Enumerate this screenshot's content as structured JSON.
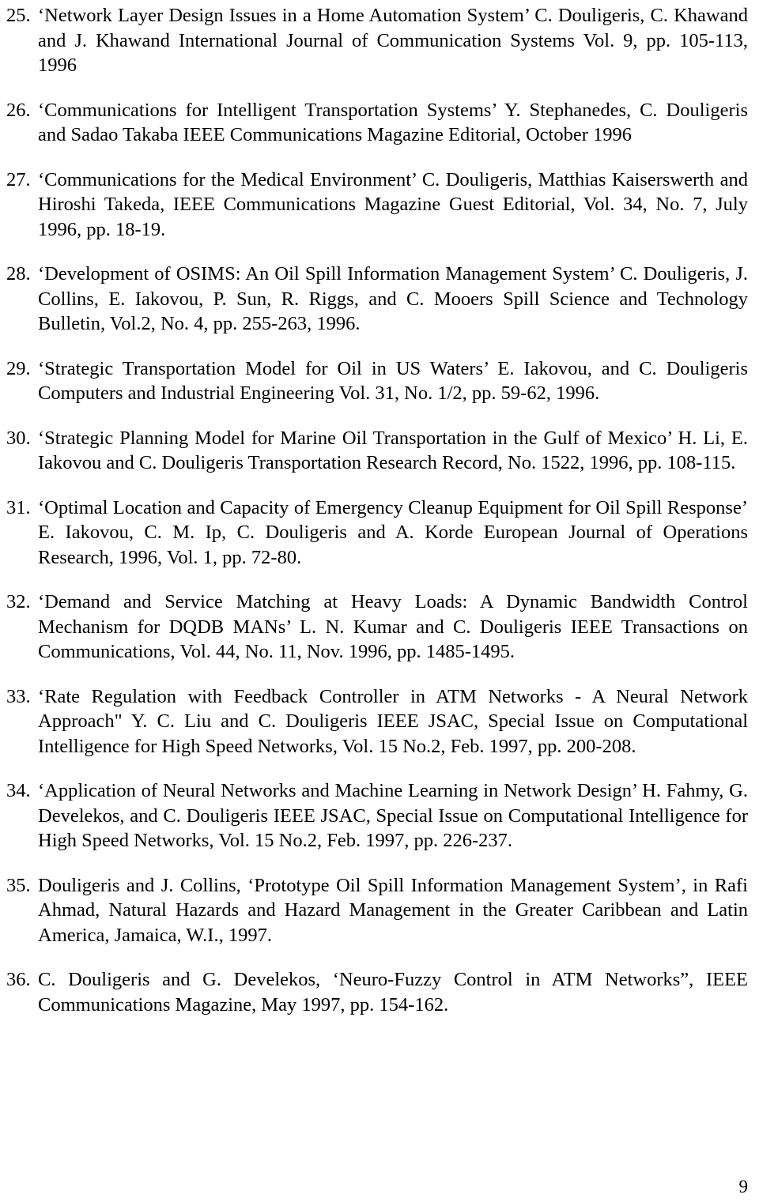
{
  "document": {
    "page_number": "9",
    "references": [
      {
        "number": "25.",
        "text": "‘Network Layer Design Issues  in a Home Automation System’ C. Douligeris, C. Khawand and  J. Khawand International Journal of Communication Systems Vol. 9, pp. 105-113, 1996"
      },
      {
        "number": "26.",
        "text": "‘Communications for Intelligent Transportation Systems’ Y. Stephanedes, C. Douligeris and Sadao Takaba IEEE Communications Magazine Editorial, October 1996"
      },
      {
        "number": "27.",
        "text": "‘Communications for the Medical Environment’ C. Douligeris, Matthias Kaiserswerth and Hiroshi Takeda, IEEE Communications Magazine Guest Editorial, Vol. 34, No. 7, July 1996, pp. 18-19."
      },
      {
        "number": "28.",
        "text": "‘Development of OSIMS: An Oil Spill Information Management System’ C. Douligeris, J. Collins, E. Iakovou, P. Sun, R. Riggs, and C. Mooers Spill Science and Technology Bulletin,  Vol.2, No. 4, pp. 255-263, 1996."
      },
      {
        "number": "29.",
        "text": "‘Strategic Transportation Model for Oil in US Waters’ E. Iakovou, and C. Douligeris Computers and Industrial Engineering Vol. 31, No. 1/2, pp.  59-62, 1996."
      },
      {
        "number": "30.",
        "text": "‘Strategic Planning Model for Marine Oil Transportation in the Gulf of Mexico’ H. Li, E. Iakovou and C. Douligeris Transportation Research Record, No. 1522, 1996, pp. 108-115."
      },
      {
        "number": "31.",
        "text": "‘Optimal Location and Capacity of Emergency Cleanup Equipment for Oil Spill Response’ E. Iakovou, C. M. Ip, C. Douligeris and A. Korde European Journal of Operations Research, 1996, Vol. 1, pp. 72-80."
      },
      {
        "number": "32.",
        "text": "‘Demand and Service Matching at Heavy Loads: A Dynamic Bandwidth Control Mechanism for DQDB MANs’ L. N. Kumar and C. Douligeris IEEE Transactions on Communications, Vol. 44, No. 11, Nov. 1996, pp. 1485-1495."
      },
      {
        "number": "33.",
        "text": "‘Rate Regulation with Feedback Controller in ATM Networks - A Neural Network Approach\" Y. C. Liu and C. Douligeris IEEE JSAC,  Special Issue on Computational Intelligence for High Speed Networks, Vol. 15 No.2, Feb. 1997, pp. 200-208."
      },
      {
        "number": "34.",
        "text": "‘Application of Neural Networks and Machine Learning in Network Design’ H. Fahmy, G. Develekos, and C. Douligeris IEEE JSAC, Special Issue on Computational Intelligence for High Speed Networks, Vol. 15 No.2, Feb. 1997, pp. 226-237."
      },
      {
        "number": "35.",
        "text": "Douligeris and J. Collins, ‘Prototype Oil Spill Information Management System’, in Rafi Ahmad, Natural Hazards and Hazard Management in the Greater Caribbean and Latin America, Jamaica, W.I., 1997."
      },
      {
        "number": "36.",
        "text": "C. Douligeris and G. Develekos, ‘Neuro-Fuzzy Control in ATM Networks”, IEEE Communications Magazine, May 1997, pp. 154-162."
      }
    ]
  }
}
